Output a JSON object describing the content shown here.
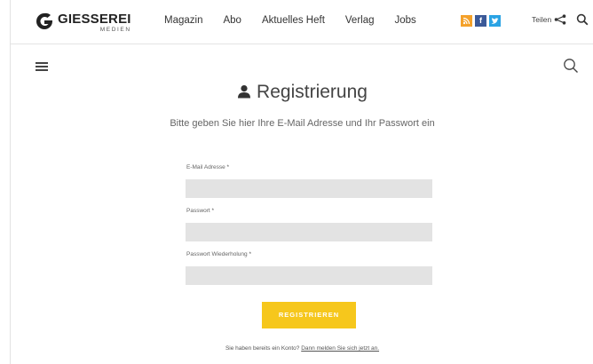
{
  "header": {
    "logo_main": "GIESSEREI",
    "logo_sub": "MEDIEN",
    "nav": [
      "Magazin",
      "Abo",
      "Aktuelles Heft",
      "Verlag",
      "Jobs"
    ],
    "social": [
      {
        "name": "rss-icon",
        "glyph": "◔",
        "color": "#f4a12a"
      },
      {
        "name": "facebook-icon",
        "glyph": "f",
        "color": "#3b5998"
      },
      {
        "name": "twitter-icon",
        "glyph": "t",
        "color": "#2aa3e4"
      }
    ],
    "share_label": "Teilen"
  },
  "main": {
    "title": "Registrierung",
    "subtitle": "Bitte geben Sie hier Ihre E-Mail Adresse und Ihr Passwort ein",
    "fields": [
      {
        "label": "E-Mail Adresse",
        "required": "*",
        "value": ""
      },
      {
        "label": "Passwort",
        "required": "*",
        "value": ""
      },
      {
        "label": "Passwort Wiederholung",
        "required": "*",
        "value": ""
      }
    ],
    "submit_label": "REGISTRIEREN",
    "login_prompt": "Sie haben bereits ein Konto?",
    "login_link": "Dann melden Sie sich jetzt an."
  },
  "colors": {
    "accent_button": "#f6c71c",
    "field_bg": "#e3e3e3"
  }
}
